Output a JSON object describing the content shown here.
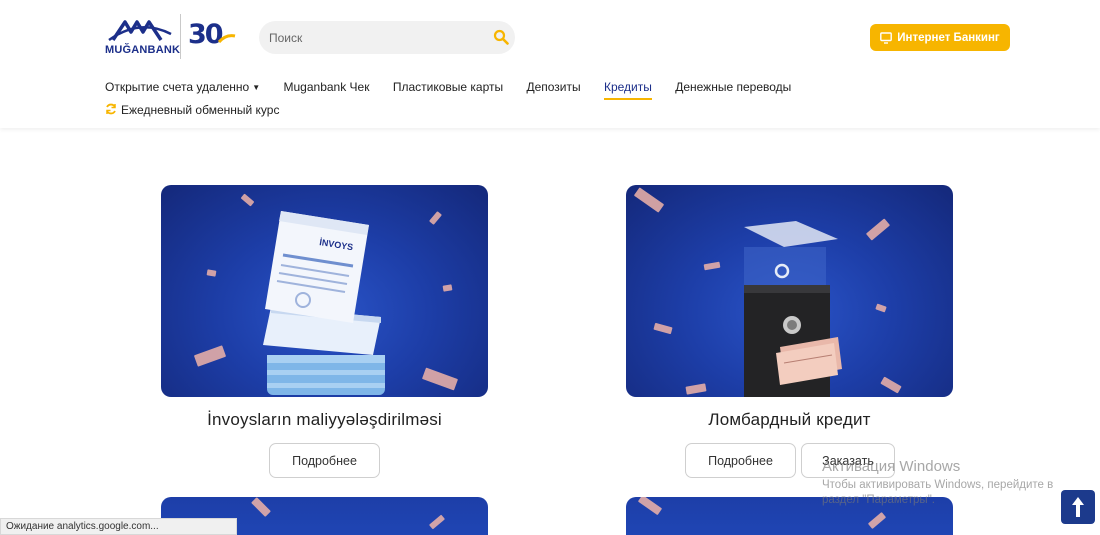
{
  "header": {
    "logo_text": "MUĞANBANK",
    "logo_anniversary": "30",
    "search": {
      "placeholder": "Поиск",
      "value": ""
    },
    "internet_banking_label": "Интернет Банкинг",
    "colors": {
      "brand": "#1c2f8a",
      "accent": "#f7b500"
    }
  },
  "nav": {
    "items": [
      {
        "label": "Открытие счета удаленно",
        "has_dropdown": true
      },
      {
        "label": "Muganbank Чек"
      },
      {
        "label": "Пластиковые карты"
      },
      {
        "label": "Депозиты"
      },
      {
        "label": "Кредиты",
        "active": true
      },
      {
        "label": "Денежные переводы"
      },
      {
        "label": "Ежедневный обменный курс",
        "icon": "refresh-icon"
      }
    ]
  },
  "cards": [
    {
      "title": "İnvoysların maliyyələşdirilməsi",
      "image_label": "İNVOYS",
      "buttons": [
        "Подробнее"
      ]
    },
    {
      "title": "Ломбардный кредит",
      "buttons": [
        "Подробнее",
        "Заказать"
      ]
    }
  ],
  "windows_activation": {
    "title": "Активация Windows",
    "line1": "Чтобы активировать Windows, перейдите в",
    "line2": "раздел \"Параметры\"."
  },
  "status_bar": "Ожидание analytics.google.com..."
}
